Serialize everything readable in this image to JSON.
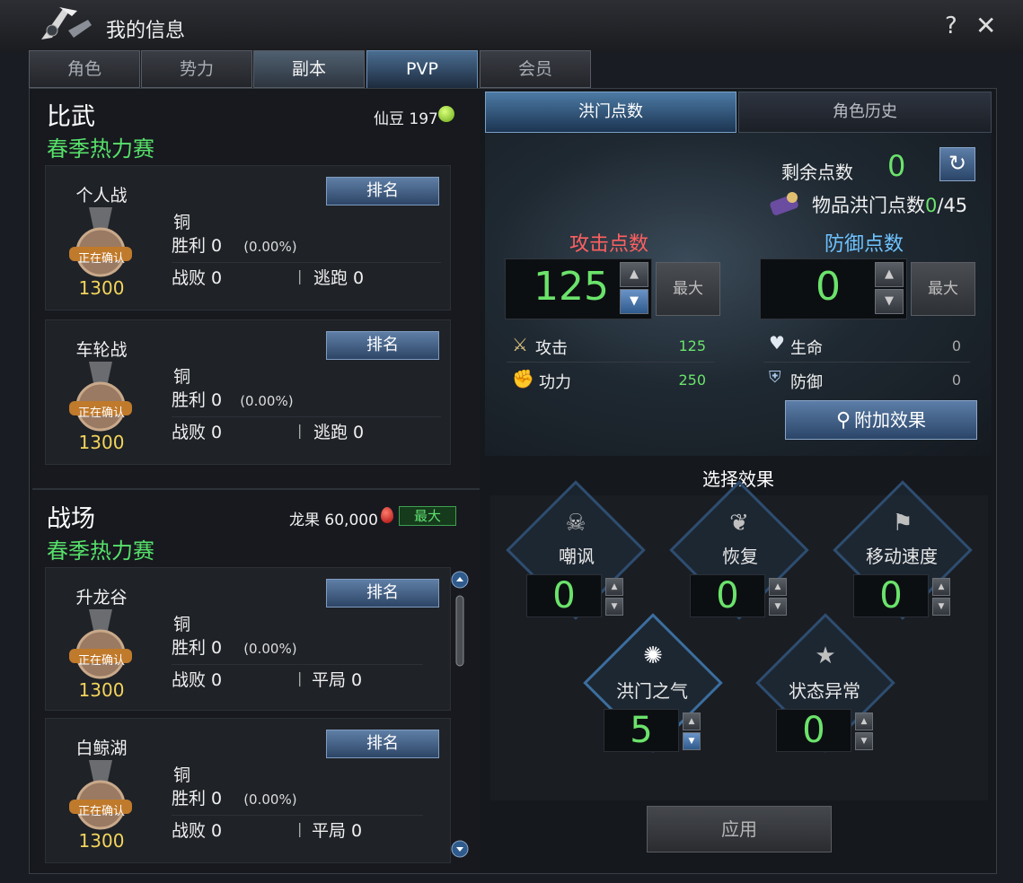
{
  "window": {
    "title": "我的信息",
    "help": "?",
    "close": "✕"
  },
  "tabs": [
    {
      "label": "角色",
      "state": "normal"
    },
    {
      "label": "势力",
      "state": "normal"
    },
    {
      "label": "副本",
      "state": "selected"
    },
    {
      "label": "PVP",
      "state": "active"
    },
    {
      "label": "会员",
      "state": "normal"
    }
  ],
  "duel": {
    "title": "比武",
    "subtitle": "春季热力赛",
    "currency_label": "仙豆 197",
    "modes": [
      {
        "name": "个人战",
        "medal_label": "正在确认",
        "score": "1300",
        "rank_button": "排名",
        "tier": "铜",
        "wins_label": "胜利 0",
        "win_rate": "(0.00%)",
        "losses_label": "战败 0",
        "sep": "|",
        "flee_label": "逃跑 0"
      },
      {
        "name": "车轮战",
        "medal_label": "正在确认",
        "score": "1300",
        "rank_button": "排名",
        "tier": "铜",
        "wins_label": "胜利 0",
        "win_rate": "(0.00%)",
        "losses_label": "战败 0",
        "sep": "|",
        "flee_label": "逃跑 0"
      }
    ]
  },
  "battlefield": {
    "title": "战场",
    "subtitle": "春季热力赛",
    "currency_label": "龙果 60,000",
    "max_badge": "最大",
    "maps": [
      {
        "name": "升龙谷",
        "medal_label": "正在确认",
        "score": "1300",
        "rank_button": "排名",
        "tier": "铜",
        "wins_label": "胜利 0",
        "win_rate": "(0.00%)",
        "losses_label": "战败 0",
        "sep": "|",
        "draw_label": "平局 0"
      },
      {
        "name": "白鲸湖",
        "medal_label": "正在确认",
        "score": "1300",
        "rank_button": "排名",
        "tier": "铜",
        "wins_label": "胜利 0",
        "win_rate": "(0.00%)",
        "losses_label": "战败 0",
        "sep": "|",
        "draw_label": "平局 0"
      }
    ]
  },
  "right_tabs": [
    {
      "label": "洪门点数"
    },
    {
      "label": "角色历史"
    }
  ],
  "points": {
    "remaining_label": "剩余点数",
    "remaining_value": "0",
    "item_points_label": "物品洪门点数",
    "item_points_value": "0",
    "item_points_max": "/45",
    "attack": {
      "title": "攻击点数",
      "value": "125",
      "max_button": "最大"
    },
    "defense": {
      "title": "防御点数",
      "value": "0",
      "max_button": "最大"
    },
    "stats": [
      {
        "label": "攻击",
        "value": "125"
      },
      {
        "label": "功力",
        "value": "250"
      },
      {
        "label": "生命",
        "value": "0"
      },
      {
        "label": "防御",
        "value": "0"
      }
    ],
    "extra_effect_button": "附加效果"
  },
  "effects": {
    "title": "选择效果",
    "items": [
      {
        "label": "嘲讽",
        "value": "0"
      },
      {
        "label": "恢复",
        "value": "0"
      },
      {
        "label": "移动速度",
        "value": "0"
      },
      {
        "label": "洪门之气",
        "value": "5"
      },
      {
        "label": "状态异常",
        "value": "0"
      }
    ],
    "apply_button": "应用"
  },
  "colors": {
    "green": "#6be36b",
    "red": "#ff6060",
    "blue": "#6fc3ff",
    "accent": "#5f7fa6"
  }
}
